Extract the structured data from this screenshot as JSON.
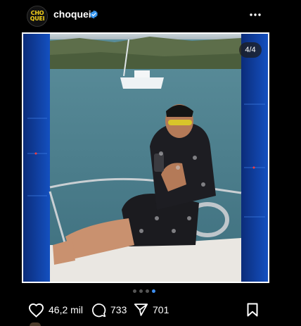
{
  "header": {
    "avatar_line1": "CHO",
    "avatar_line2": "QUEI",
    "username": "choquei",
    "verified_icon": "verified-badge-icon",
    "more_icon": "more-horizontal-icon"
  },
  "post": {
    "image_counter": "4/4",
    "carousel": {
      "total": 4,
      "active_index": 3
    }
  },
  "actions": {
    "likes": "46,2 mil",
    "comments": "733",
    "shares": "701",
    "like_icon": "heart-icon",
    "comment_icon": "comment-icon",
    "share_icon": "send-icon",
    "save_icon": "bookmark-icon"
  },
  "colors": {
    "background": "#000000",
    "accent_dot": "#3d8ef0",
    "verified": "#3897f0",
    "logo_yellow": "#f5d21b"
  }
}
